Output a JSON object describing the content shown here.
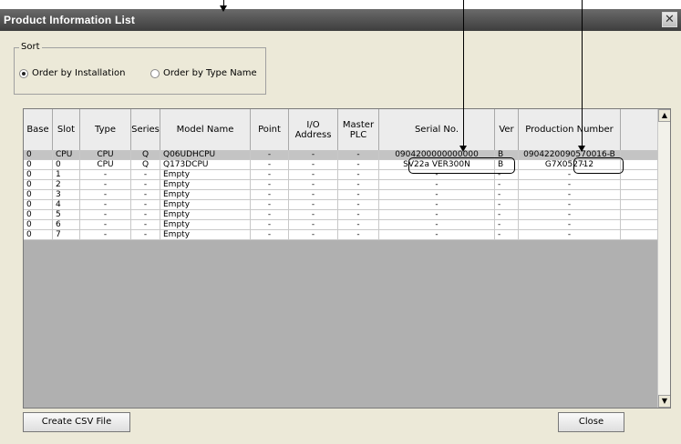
{
  "window": {
    "title": "Product Information List",
    "close_symbol": "✕"
  },
  "sort": {
    "legend": "Sort",
    "option_installation": "Order by Installation",
    "option_type_name": "Order by Type Name",
    "selected": "Order by Installation"
  },
  "table": {
    "headers": [
      "Base",
      "Slot",
      "Type",
      "Series",
      "Model Name",
      "Point",
      "I/O Address",
      "Master PLC",
      "Serial No.",
      "Ver",
      "Production Number"
    ],
    "rows": [
      [
        "0",
        "CPU",
        "CPU",
        "Q",
        "Q06UDHCPU",
        "-",
        "-",
        "-",
        "0904200000000000",
        "B",
        "0904220090570016-B"
      ],
      [
        "0",
        "0",
        "CPU",
        "Q",
        "Q173DCPU",
        "-",
        "-",
        "-",
        "SV22a  VER300N",
        "B",
        "G7X052712",
        "-"
      ],
      [
        "0",
        "1",
        "-",
        "-",
        "Empty",
        "-",
        "-",
        "-",
        "-",
        "-",
        "-"
      ],
      [
        "0",
        "2",
        "-",
        "-",
        "Empty",
        "-",
        "-",
        "-",
        "-",
        "-",
        "-"
      ],
      [
        "0",
        "3",
        "-",
        "-",
        "Empty",
        "-",
        "-",
        "-",
        "-",
        "-",
        "-"
      ],
      [
        "0",
        "4",
        "-",
        "-",
        "Empty",
        "-",
        "-",
        "-",
        "-",
        "-",
        "-"
      ],
      [
        "0",
        "5",
        "-",
        "-",
        "Empty",
        "-",
        "-",
        "-",
        "-",
        "-",
        "-"
      ],
      [
        "0",
        "6",
        "-",
        "-",
        "Empty",
        "-",
        "-",
        "-",
        "-",
        "-",
        "-"
      ],
      [
        "0",
        "7",
        "-",
        "-",
        "Empty",
        "-",
        "-",
        "-",
        "-",
        "-",
        "-"
      ]
    ],
    "selected_row": 0
  },
  "buttons": {
    "create_csv": "Create CSV File",
    "close": "Close"
  },
  "scroll": {
    "up": "▲",
    "down": "▼"
  }
}
